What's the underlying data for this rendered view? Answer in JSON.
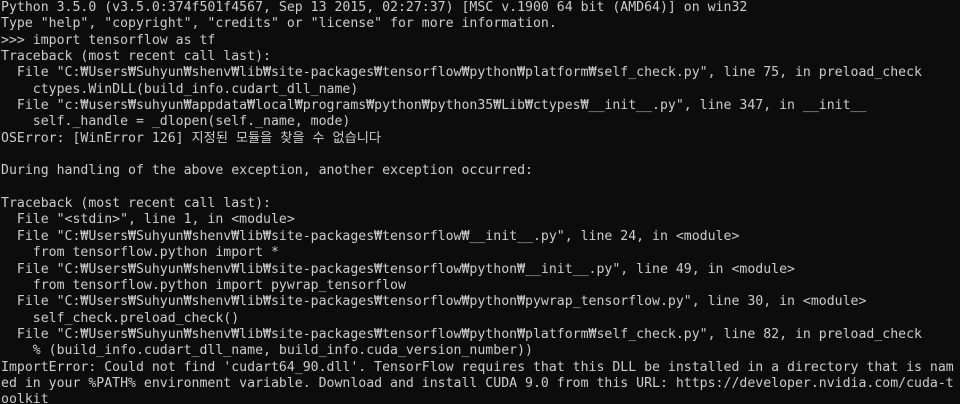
{
  "console": {
    "lines": [
      "Python 3.5.0 (v3.5.0:374f501f4567, Sep 13 2015, 02:27:37) [MSC v.1900 64 bit (AMD64)] on win32",
      "Type \"help\", \"copyright\", \"credits\" or \"license\" for more information.",
      ">>> import tensorflow as tf",
      "Traceback (most recent call last):",
      "  File \"C:₩Users₩Suhyun₩shenv₩lib₩site-packages₩tensorflow₩python₩platform₩self_check.py\", line 75, in preload_check",
      "    ctypes.WinDLL(build_info.cudart_dll_name)",
      "  File \"c:₩users₩suhyun₩appdata₩local₩programs₩python₩python35₩Lib₩ctypes₩__init__.py\", line 347, in __init__",
      "    self._handle = _dlopen(self._name, mode)",
      "OSError: [WinError 126] 지정된 모듈을 찾을 수 없습니다",
      "",
      "During handling of the above exception, another exception occurred:",
      "",
      "Traceback (most recent call last):",
      "  File \"<stdin>\", line 1, in <module>",
      "  File \"C:₩Users₩Suhyun₩shenv₩lib₩site-packages₩tensorflow₩__init__.py\", line 24, in <module>",
      "    from tensorflow.python import *",
      "  File \"C:₩Users₩Suhyun₩shenv₩lib₩site-packages₩tensorflow₩python₩__init__.py\", line 49, in <module>",
      "    from tensorflow.python import pywrap_tensorflow",
      "  File \"C:₩Users₩Suhyun₩shenv₩lib₩site-packages₩tensorflow₩python₩pywrap_tensorflow.py\", line 30, in <module>",
      "    self_check.preload_check()",
      "  File \"C:₩Users₩Suhyun₩shenv₩lib₩site-packages₩tensorflow₩python₩platform₩self_check.py\", line 82, in preload_check",
      "    % (build_info.cudart_dll_name, build_info.cuda_version_number))",
      "ImportError: Could not find 'cudart64_90.dll'. TensorFlow requires that this DLL be installed in a directory that is nam",
      "ed in your %PATH% environment variable. Download and install CUDA 9.0 from this URL: https://developer.nvidia.com/cuda-t",
      "oolkit"
    ]
  }
}
